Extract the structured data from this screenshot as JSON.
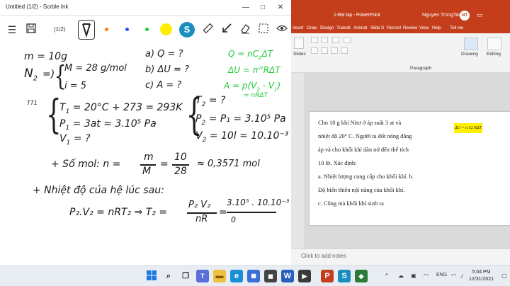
{
  "ink": {
    "window_title": "Untitled (1/2) - Scrble Ink",
    "page_indicator": "(1/2)",
    "colors": [
      "#ff7f00",
      "#2255ee",
      "#22c93a",
      "#ffee00",
      "#1a8fbf"
    ],
    "icons": [
      "menu-icon",
      "save-icon",
      "pen-icon",
      "ruler-icon",
      "arrow-icon",
      "eraser-icon",
      "select-icon",
      "view-icon"
    ]
  },
  "notes": {
    "line1": "m = 10g",
    "n2": "N",
    "n2_sub": "2",
    "eq": "=)",
    "m_eq": "M = 28 g/mol",
    "i_eq": "i = 5",
    "qa": "a)  Q = ?",
    "qb": "b)  ΔU = ?",
    "qc": "c)  A = ?",
    "g1": "Q = nC",
    "g1b": "p",
    "g1c": "ΔT",
    "g2": "ΔU = n",
    "g2f": "i/2",
    "g2c": "RΔT",
    "g3": "A = p(V",
    "g3b": "2",
    "g3c": " - V",
    "g3d": "1",
    "g3e": ")",
    "g4": "= nRΔT",
    "tt1": "TT1",
    "t1": "T",
    "t1s": "1",
    "t1v": " = 20°C + 273 = 293K",
    "p1": "P",
    "p1s": "1",
    "p1v": " = 3at ≈ 3.10⁵ Pa",
    "v1": "V",
    "v1s": "1",
    "v1v": " = ?",
    "t2": "T",
    "t2s": "2",
    "t2v": " = ?",
    "p2": "P",
    "p2s": "2",
    "p2v": " = P₁ = 3.10⁵ Pa",
    "v2": "V",
    "v2s": "2",
    "v2v": " = 10l = 10.10⁻³ m³",
    "mol1": "+  Số mol:  n =",
    "frac_m": "m",
    "frac_M": "M",
    "eq2": "=",
    "frac_10": "10",
    "frac_28": "28",
    "mol_res": "≈ 0,3571 mol",
    "line_heat": "+  Nhiệt độ của hệ lúc sau:",
    "pv": "P₂.V₂ = nRT₂  ⇒  T₂ =",
    "frac_pv": "P₂ V₂",
    "frac_nr": "nR",
    "eq3": "=",
    "frac_num": "3.10⁵ . 10.10⁻³",
    "frac_den": "0"
  },
  "ppt": {
    "title": "1-Bai tap  -  PowerPoint",
    "user": "Nguyen TrongTam",
    "avatar": "NT",
    "tabs": [
      "Insert",
      "Draw",
      "Design",
      "Transiti",
      "Animat",
      "Slide S",
      "Record",
      "Review",
      "View",
      "Help",
      "Tell me"
    ],
    "ribbon": {
      "slides": "Slides",
      "paragraph": "Paragraph",
      "drawing": "Drawing",
      "editing": "Editing"
    },
    "formula": "ΔU = n i/2 RΔT",
    "slide_lines": [
      "Cho 10 g khí Nitơ ở áp suất 3 at và",
      "nhiệt độ 20° C. Người ta đốt nóng đẳng",
      "áp và cho khối khí dãn nở đến thể tích",
      "10 lít. Xác định:",
      "a. Nhiệt lượng cung cấp cho khối khí. b.",
      "Độ biến thiên nội năng của khối khí.",
      "c. Công mà khối khí sinh ra"
    ],
    "notes_placeholder": "Click to add notes"
  },
  "taskbar": {
    "lang": "ENG",
    "time": "5:04 PM",
    "date": "12/31/2021"
  }
}
